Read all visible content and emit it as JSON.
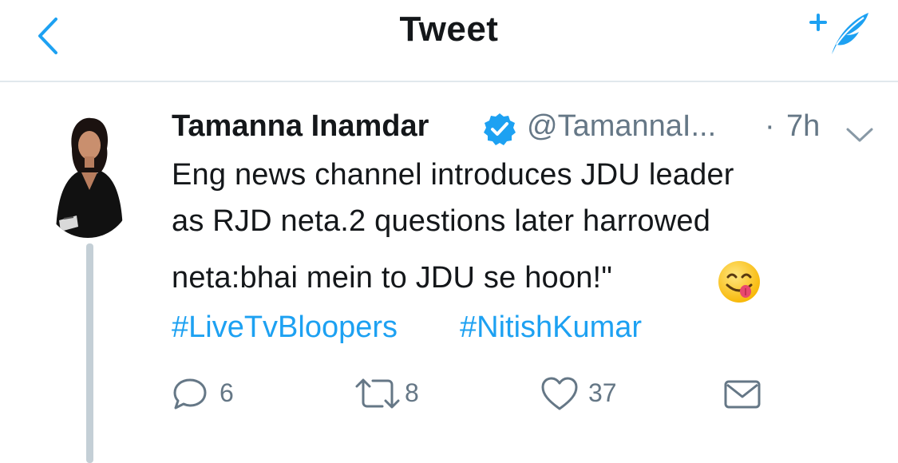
{
  "header": {
    "title": "Tweet",
    "back_icon": "chevron-left-icon",
    "compose_icon": "compose-feather-icon"
  },
  "tweet": {
    "author_name": "Tamanna Inamdar",
    "handle": "@TamannaI...",
    "separator": "·",
    "time": "7h",
    "text_lines": [
      "Eng news channel introduces JDU leader",
      "as RJD neta.2 questions later harrowed",
      "neta:bhai mein to JDU se hoon!\""
    ],
    "emoji": "face-savoring-food-emoji",
    "hashtags": [
      "#LiveTvBloopers",
      "#NitishKumar"
    ]
  },
  "actions": {
    "replies": "6",
    "retweets": "8",
    "likes": "37"
  },
  "colors": {
    "accent": "#1da1f2",
    "text": "#14171a",
    "secondary": "#657786",
    "divider": "#e1e8ed",
    "thread_line": "#c4cfd6"
  }
}
